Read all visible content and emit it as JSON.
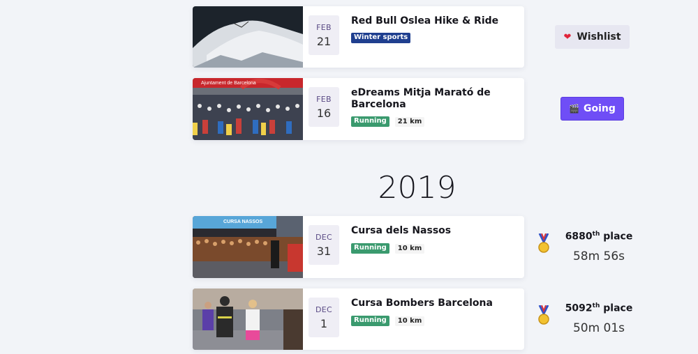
{
  "events": [
    {
      "month": "FEB",
      "day": "21",
      "title": "Red Bull Oslea Hike & Ride",
      "tag": "Winter sports",
      "tag_color": "#1f3f8f",
      "distance": "",
      "image": "snowy-mountain-photo"
    },
    {
      "month": "FEB",
      "day": "16",
      "title": "eDreams Mitja Marató de Barcelona",
      "tag": "Running",
      "tag_color": "#3a9a6e",
      "distance": "21 km",
      "image": "marathon-crowd-photo",
      "banner_text": "Ajuntament de Barcelona"
    },
    {
      "month": "DEC",
      "day": "31",
      "title": "Cursa dels Nassos",
      "tag": "Running",
      "tag_color": "#3a9a6e",
      "distance": "10 km",
      "image": "night-race-start-photo",
      "banner_text": "CURSA NASSOS"
    },
    {
      "month": "DEC",
      "day": "1",
      "title": "Cursa Bombers Barcelona",
      "tag": "Running",
      "tag_color": "#3a9a6e",
      "distance": "10 km",
      "image": "firefighter-runners-photo"
    }
  ],
  "buttons": {
    "wishlist": "Wishlist",
    "wishlist_icon": "heart-icon",
    "going": "Going",
    "going_icon": "clapperboard-icon",
    "going_color": "#6f4ef6"
  },
  "year_heading": "2019",
  "results": [
    {
      "place_number": "6880",
      "place_suffix": "th",
      "place_word": "place",
      "time": "58m 56s",
      "icon": "medal-icon"
    },
    {
      "place_number": "5092",
      "place_suffix": "th",
      "place_word": "place",
      "time": "50m 01s",
      "icon": "medal-icon"
    }
  ]
}
